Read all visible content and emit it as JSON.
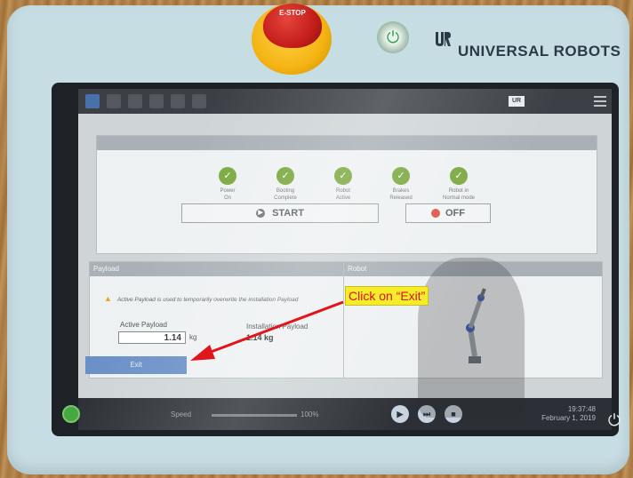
{
  "hardware": {
    "estop_label": "E-STOP",
    "brand": "UNIVERSAL ROBOTS",
    "brand_logo_icon": "ur-logo-icon",
    "power_button_icon": "power-icon"
  },
  "topbar": {
    "info_line1": "",
    "info_line2": "",
    "badge": "UR"
  },
  "init": {
    "steps": [
      {
        "label_1": "Power",
        "label_2": "On"
      },
      {
        "label_1": "Booting",
        "label_2": "Complete"
      },
      {
        "label_1": "Robot",
        "label_2": "Active"
      },
      {
        "label_1": "Brakes",
        "label_2": "Released"
      },
      {
        "label_1": "Robot in",
        "label_2": "Normal mode"
      }
    ],
    "start_label": "START",
    "off_label": "OFF"
  },
  "payload": {
    "title": "Payload",
    "warning": "Active Payload is used to temporarily overwrite the installation Payload",
    "active_label": "Active Payload",
    "active_value": "1.14",
    "unit": "kg",
    "installation_label": "Installation Payload",
    "installation_value": "1.14",
    "installation_unit": "kg"
  },
  "robot_panel": {
    "title": "Robot"
  },
  "exit_label": "Exit",
  "bottombar": {
    "speed_label": "Speed",
    "speed_value": "100%",
    "time": "19:37:48",
    "date": "February 1, 2019"
  },
  "annotation": {
    "callout": "Click on “Exit”",
    "callout_bg": "#f5ec2a",
    "callout_text_color": "#d8141e"
  },
  "colors": {
    "pendant": "#c6dde3",
    "step_check": "#7aa83f",
    "exit_button": "#6a90c8",
    "arrow": "#e1151c"
  }
}
